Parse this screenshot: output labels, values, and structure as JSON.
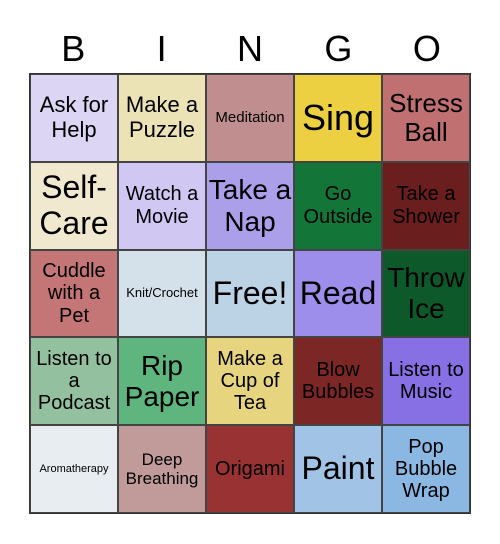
{
  "header": [
    "B",
    "I",
    "N",
    "G",
    "O"
  ],
  "cells": [
    {
      "text": "Ask for Help",
      "color": "#dcd6f4",
      "size": 22
    },
    {
      "text": "Make a Puzzle",
      "color": "#ebe2b6",
      "size": 22
    },
    {
      "text": "Meditation",
      "color": "#c08e8e",
      "size": 15
    },
    {
      "text": "Sing",
      "color": "#edd042",
      "size": 36
    },
    {
      "text": "Stress Ball",
      "color": "#c07070",
      "size": 26
    },
    {
      "text": "Self-Care",
      "color": "#f1e9cf",
      "size": 32
    },
    {
      "text": "Watch a Movie",
      "color": "#d0c8f2",
      "size": 20
    },
    {
      "text": "Take a Nap",
      "color": "#ab9fea",
      "size": 28
    },
    {
      "text": "Go Outside",
      "color": "#137538",
      "size": 20
    },
    {
      "text": "Take a Shower",
      "color": "#6b1e1e",
      "size": 20
    },
    {
      "text": "Cuddle with a Pet",
      "color": "#c47676",
      "size": 20
    },
    {
      "text": "Knit/Crochet",
      "color": "#d4e1ea",
      "size": 13
    },
    {
      "text": "Free!",
      "color": "#bcd3e6",
      "size": 32
    },
    {
      "text": "Read",
      "color": "#9e8eec",
      "size": 32
    },
    {
      "text": "Throw Ice",
      "color": "#0e592a",
      "size": 28
    },
    {
      "text": "Listen to a Podcast",
      "color": "#93c1a0",
      "size": 20
    },
    {
      "text": "Rip Paper",
      "color": "#5eb67e",
      "size": 28
    },
    {
      "text": "Make a Cup of Tea",
      "color": "#e6d47e",
      "size": 20
    },
    {
      "text": "Blow Bubbles",
      "color": "#7d2626",
      "size": 20
    },
    {
      "text": "Listen to Music",
      "color": "#8670e4",
      "size": 20
    },
    {
      "text": "Aromatherapy",
      "color": "#e8edf2",
      "size": 11
    },
    {
      "text": "Deep Breathing",
      "color": "#c19a9a",
      "size": 17
    },
    {
      "text": "Origami",
      "color": "#993232",
      "size": 20
    },
    {
      "text": "Paint",
      "color": "#a1c4e6",
      "size": 32
    },
    {
      "text": "Pop Bubble Wrap",
      "color": "#8ab8e2",
      "size": 20
    }
  ]
}
